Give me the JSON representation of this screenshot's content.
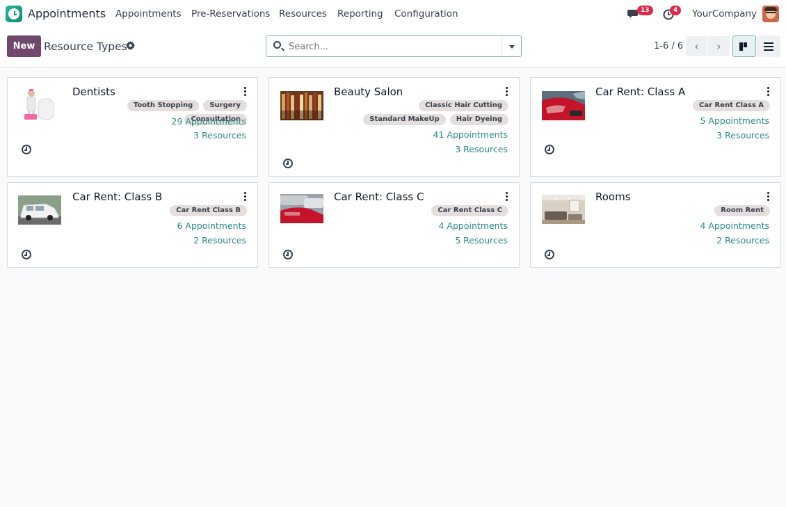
{
  "navbar": {
    "brand": "Appointments",
    "menus": [
      "Appointments",
      "Pre-Reservations",
      "Resources",
      "Reporting",
      "Configuration"
    ],
    "messages_badge": "13",
    "activities_badge": "4",
    "company": "YourCompany",
    "icons": [
      "app-logo-icon",
      "chat-icon",
      "activity-clock-icon",
      "user-avatar"
    ]
  },
  "control": {
    "new_label": "New",
    "title": "Resource Types",
    "search_placeholder": "Search...",
    "pager": "1-6 / 6",
    "prev_glyph": "‹",
    "next_glyph": "›"
  },
  "colors": {
    "primary": "#71476b",
    "link": "#2a8a86",
    "badge": "#e0294a",
    "tag_bg": "#e5dedc"
  },
  "cards": [
    {
      "title": "Dentists",
      "image": "dentist-figure",
      "tags": [
        "Tooth Stopping",
        "Surgery",
        "Consultation"
      ],
      "appointments": "29 Appointments",
      "resources": "3 Resources"
    },
    {
      "title": "Beauty Salon",
      "image": "salon-brushes",
      "tags": [
        "Classic Hair Cutting",
        "Standard MakeUp",
        "Hair Dyeing"
      ],
      "appointments": "41 Appointments",
      "resources": "3 Resources"
    },
    {
      "title": "Car Rent: Class A",
      "image": "red-car",
      "tags": [
        "Car Rent Class A"
      ],
      "appointments": "5 Appointments",
      "resources": "3 Resources"
    },
    {
      "title": "Car Rent: Class B",
      "image": "white-suv",
      "tags": [
        "Car Rent Class B"
      ],
      "appointments": "6 Appointments",
      "resources": "2 Resources"
    },
    {
      "title": "Car Rent: Class C",
      "image": "parked-cars",
      "tags": [
        "Car Rent Class C"
      ],
      "appointments": "4 Appointments",
      "resources": "5 Resources"
    },
    {
      "title": "Rooms",
      "image": "room-interior",
      "tags": [
        "Room Rent"
      ],
      "appointments": "4 Appointments",
      "resources": "2 Resources"
    }
  ]
}
